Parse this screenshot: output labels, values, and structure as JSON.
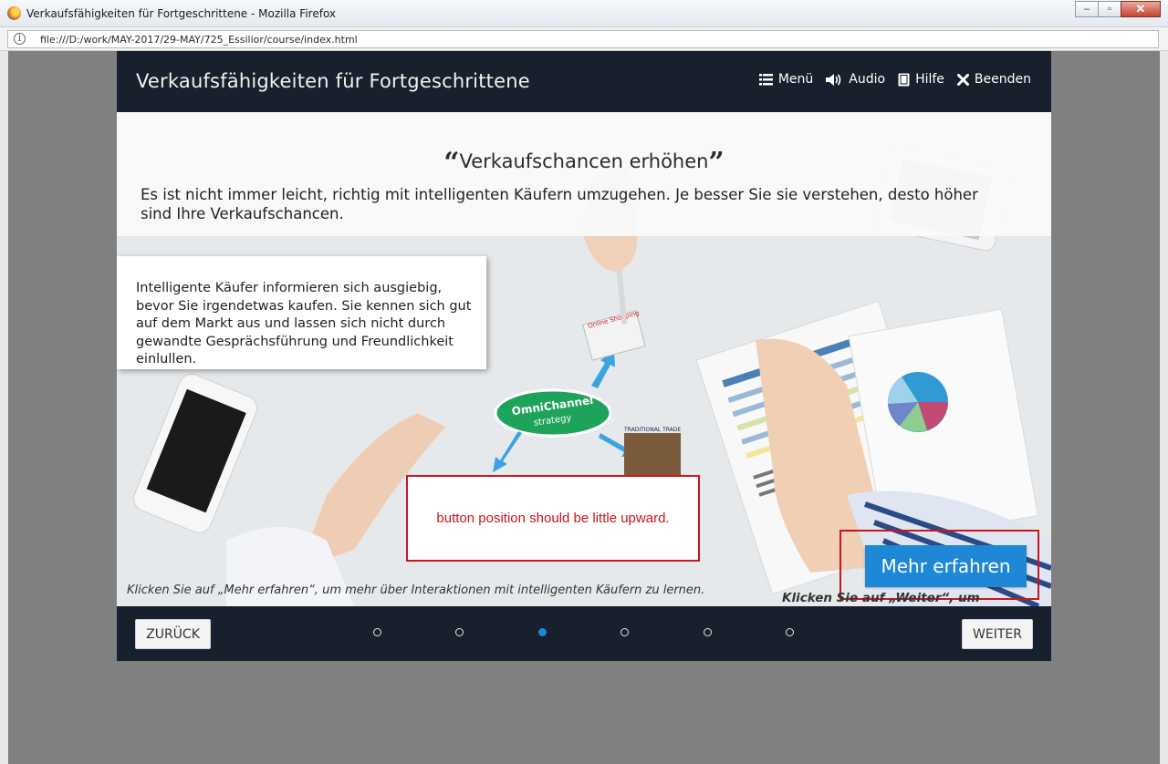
{
  "window": {
    "title": "Verkaufsfähigkeiten für Fortgeschrittene - Mozilla Firefox",
    "url": "file:///D:/work/MAY-2017/29-MAY/725_Essilior/course/index.html",
    "controls": {
      "minimize": "–",
      "maximize": "▫",
      "close": "✕"
    }
  },
  "course": {
    "title": "Verkaufsfähigkeiten für Fortgeschrittene",
    "nav": [
      {
        "label": "Menü",
        "icon": "menu-list-icon"
      },
      {
        "label": "Audio",
        "icon": "speaker-icon"
      },
      {
        "label": "Hilfe",
        "icon": "book-icon"
      },
      {
        "label": "Beenden",
        "icon": "close-icon"
      }
    ]
  },
  "slide": {
    "heading": "Verkaufschancen erhöhen",
    "quote_open": "“",
    "quote_close": "”",
    "intro": "Es ist nicht immer leicht, richtig mit intelligenten Käufern umzugehen. Je besser Sie sie verstehen, desto höher sind Ihre Verkaufschancen.",
    "info_box": "Intelligente Käufer informieren sich ausgiebig, bevor Sie irgendetwas kaufen. Sie kennen sich gut auf dem Markt aus und lassen sich nicht durch gewandte Gesprächsführung und Freundlichkeit einlullen.",
    "annotation": "button position should be little upward.",
    "more_button": "Mehr erfahren",
    "hint_left": "Klicken Sie auf „Mehr erfahren“, um mehr über Interaktionen mit intelligenten Käufern zu lernen.",
    "hint_right": "Klicken Sie auf „Weiter“, um fortzufahren.",
    "photo_labels": {
      "omnichannel": "OmniChannel",
      "strategy": "strategy",
      "online": "Online Shopping",
      "trade": "TRADITIONAL TRADE"
    }
  },
  "footer": {
    "back_label": "ZURÜCK",
    "next_label": "WEITER",
    "page_count": 6,
    "current_page": 3
  },
  "colors": {
    "header_bg": "#17202c",
    "accent": "#1e88d6",
    "annotation_red": "#c8161d",
    "backdrop": "#808080"
  }
}
